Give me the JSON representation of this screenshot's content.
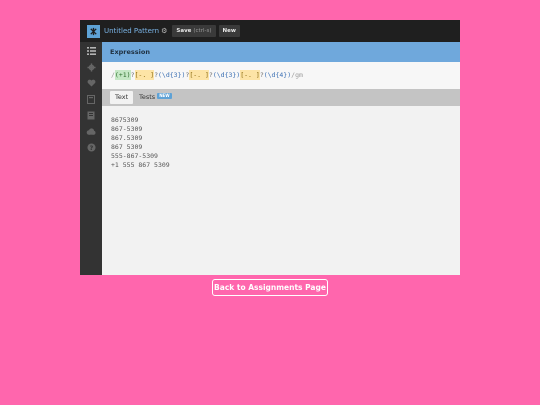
{
  "app": {
    "title": "Untitled Pattern",
    "save_label": "Save",
    "save_hint": "(ctrl-s)",
    "new_label": "New"
  },
  "sidebar": {
    "icons": [
      "menu-icon",
      "gear-icon",
      "heart-icon",
      "flag-icon",
      "book-icon",
      "cloud-icon",
      "help-icon"
    ]
  },
  "expression": {
    "header": "Expression",
    "tokens": {
      "open": "/",
      "g1": "(+1)",
      "q1": "?",
      "c1": "[-. ]",
      "q2": "?",
      "g2": "(\\d{3})",
      "q3": "?",
      "c2": "[-. ]",
      "q4": "?",
      "g3": "(\\d{3})",
      "c3": "[-. ]",
      "q5": "?",
      "g4": "(\\d{4})",
      "close": "/",
      "flags": "gm"
    }
  },
  "tabs": {
    "text": "Text",
    "tests": "Tests",
    "tests_badge": "NEW"
  },
  "text": {
    "lines": [
      "8675309",
      "867-5309",
      "867.5309",
      "867 5309",
      "555-867-5309",
      "+1 555 867 5309"
    ]
  },
  "back_button": "Back to Assignments Page",
  "colors": {
    "page_background": "#ff66ad",
    "expression_header": "#6fa8dc",
    "accent": "#5ea2d6"
  }
}
